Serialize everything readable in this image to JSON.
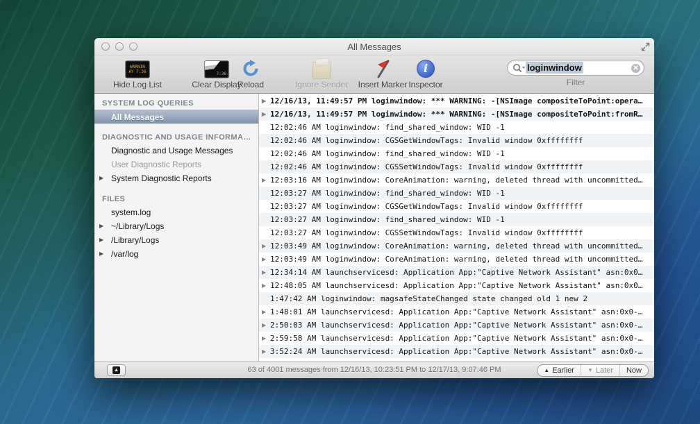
{
  "window": {
    "title": "All Messages"
  },
  "toolbar": {
    "items": [
      {
        "label": "Hide Log List",
        "icon": "console-screen-icon",
        "icon_text": "WARNIN\nAY 7:36",
        "disabled": false
      },
      {
        "label": "Clear Display",
        "icon": "console-eraser-icon",
        "icon_text": "7:36",
        "disabled": false
      },
      {
        "label": "Reload",
        "icon": "reload-arrow-icon",
        "disabled": false
      },
      {
        "label": "Ignore Sender",
        "icon": "paper-bag-icon",
        "disabled": true
      },
      {
        "label": "Insert Marker",
        "icon": "red-flag-icon",
        "disabled": false
      },
      {
        "label": "Inspector",
        "icon": "info-circle-icon",
        "disabled": false
      }
    ],
    "filter": {
      "value": "loginwindow",
      "label": "Filter",
      "clear_glyph": "✕"
    }
  },
  "sidebar": {
    "sections": [
      {
        "header": "SYSTEM LOG QUERIES",
        "items": [
          {
            "label": "All Messages",
            "selected": true
          }
        ]
      },
      {
        "header": "DIAGNOSTIC AND USAGE INFORMA…",
        "items": [
          {
            "label": "Diagnostic and Usage Messages"
          },
          {
            "label": "User Diagnostic Reports",
            "dimmed": true
          },
          {
            "label": "System Diagnostic Reports",
            "disclosure": true
          }
        ]
      },
      {
        "header": "FILES",
        "items": [
          {
            "label": "system.log"
          },
          {
            "label": "~/Library/Logs",
            "disclosure": true
          },
          {
            "label": "/Library/Logs",
            "disclosure": true
          },
          {
            "label": "/var/log",
            "disclosure": true
          }
        ]
      }
    ]
  },
  "log": {
    "rows": [
      {
        "text": "12/16/13, 11:49:57 PM loginwindow: *** WARNING: -[NSImage compositeToPoint:opera…",
        "disclosure": true,
        "bold": true
      },
      {
        "text": "12/16/13, 11:49:57 PM loginwindow: *** WARNING: -[NSImage compositeToPoint:fromR…",
        "disclosure": true,
        "bold": true
      },
      {
        "text": "12:02:46 AM loginwindow: find_shared_window: WID -1",
        "disclosure": false,
        "bold": false
      },
      {
        "text": "12:02:46 AM loginwindow: CGSGetWindowTags: Invalid window 0xffffffff",
        "disclosure": false,
        "bold": false
      },
      {
        "text": "12:02:46 AM loginwindow: find_shared_window: WID -1",
        "disclosure": false,
        "bold": false
      },
      {
        "text": "12:02:46 AM loginwindow: CGSSetWindowTags: Invalid window 0xffffffff",
        "disclosure": false,
        "bold": false
      },
      {
        "text": "12:03:16 AM loginwindow: CoreAnimation: warning, deleted thread with uncommitted…",
        "disclosure": true,
        "bold": false
      },
      {
        "text": "12:03:27 AM loginwindow: find_shared_window: WID -1",
        "disclosure": false,
        "bold": false
      },
      {
        "text": "12:03:27 AM loginwindow: CGSGetWindowTags: Invalid window 0xffffffff",
        "disclosure": false,
        "bold": false
      },
      {
        "text": "12:03:27 AM loginwindow: find_shared_window: WID -1",
        "disclosure": false,
        "bold": false
      },
      {
        "text": "12:03:27 AM loginwindow: CGSSetWindowTags: Invalid window 0xffffffff",
        "disclosure": false,
        "bold": false
      },
      {
        "text": "12:03:49 AM loginwindow: CoreAnimation: warning, deleted thread with uncommitted…",
        "disclosure": true,
        "bold": false
      },
      {
        "text": "12:03:49 AM loginwindow: CoreAnimation: warning, deleted thread with uncommitted…",
        "disclosure": true,
        "bold": false
      },
      {
        "text": "12:34:14 AM launchservicesd: Application App:\"Captive Network Assistant\" asn:0x0…",
        "disclosure": true,
        "bold": false
      },
      {
        "text": "12:48:05 AM launchservicesd: Application App:\"Captive Network Assistant\" asn:0x0…",
        "disclosure": true,
        "bold": false
      },
      {
        "text": "1:47:42 AM loginwindow: magsafeStateChanged state changed old 1 new 2",
        "disclosure": false,
        "bold": false
      },
      {
        "text": "1:48:01 AM launchservicesd: Application App:\"Captive Network Assistant\" asn:0x0-…",
        "disclosure": true,
        "bold": false
      },
      {
        "text": "2:50:03 AM launchservicesd: Application App:\"Captive Network Assistant\" asn:0x0-…",
        "disclosure": true,
        "bold": false
      },
      {
        "text": "2:59:58 AM launchservicesd: Application App:\"Captive Network Assistant\" asn:0x0-…",
        "disclosure": true,
        "bold": false
      },
      {
        "text": "3:52:24 AM launchservicesd: Application App:\"Captive Network Assistant\" asn:0x0-…",
        "disclosure": true,
        "bold": false
      }
    ]
  },
  "statusbar": {
    "summary": "63 of 4001 messages from 12/16/13, 10:23:51 PM to 12/17/13, 9:07:46 PM",
    "earlier_label": "Earlier",
    "later_label": "Later",
    "now_label": "Now"
  },
  "colors": {
    "selection_top": "#b2bece",
    "selection_bottom": "#8296b0",
    "row_stripe": "#f1f4f7",
    "search_highlight": "#bfcbd7",
    "marker_red": "#d93a2b",
    "inspector_blue": "#4268cc",
    "reload_blue": "#4f93d8",
    "console_amber": "#f0a63c"
  }
}
